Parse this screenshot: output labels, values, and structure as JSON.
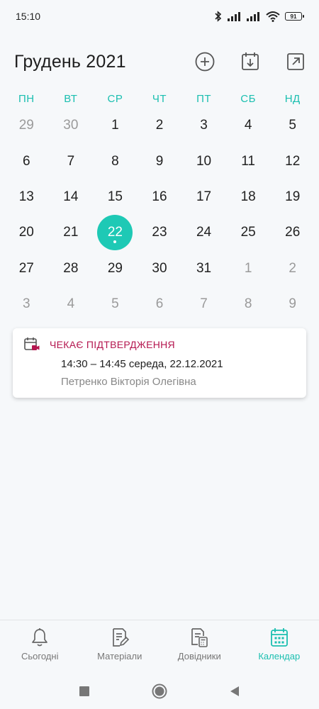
{
  "status_bar": {
    "time": "15:10",
    "battery": "91",
    "icons": [
      "bluetooth-icon",
      "signal-icon",
      "signal-icon",
      "wifi-icon",
      "battery-icon"
    ]
  },
  "header": {
    "title": "Грудень 2021",
    "actions": [
      "add-circle-icon",
      "calendar-download-icon",
      "open-external-icon"
    ]
  },
  "weekdays": [
    "ПН",
    "ВТ",
    "СР",
    "ЧТ",
    "ПТ",
    "СБ",
    "НД"
  ],
  "days": [
    {
      "label": "29",
      "muted": true
    },
    {
      "label": "30",
      "muted": true
    },
    {
      "label": "1"
    },
    {
      "label": "2"
    },
    {
      "label": "3"
    },
    {
      "label": "4"
    },
    {
      "label": "5"
    },
    {
      "label": "6"
    },
    {
      "label": "7"
    },
    {
      "label": "8"
    },
    {
      "label": "9"
    },
    {
      "label": "10"
    },
    {
      "label": "11"
    },
    {
      "label": "12"
    },
    {
      "label": "13"
    },
    {
      "label": "14"
    },
    {
      "label": "15"
    },
    {
      "label": "16"
    },
    {
      "label": "17"
    },
    {
      "label": "18"
    },
    {
      "label": "19"
    },
    {
      "label": "20"
    },
    {
      "label": "21"
    },
    {
      "label": "22",
      "selected": true,
      "has_event": true
    },
    {
      "label": "23"
    },
    {
      "label": "24"
    },
    {
      "label": "25"
    },
    {
      "label": "26"
    },
    {
      "label": "27"
    },
    {
      "label": "28"
    },
    {
      "label": "29"
    },
    {
      "label": "30"
    },
    {
      "label": "31"
    },
    {
      "label": "1",
      "muted": true
    },
    {
      "label": "2",
      "muted": true
    },
    {
      "label": "3",
      "muted": true
    },
    {
      "label": "4",
      "muted": true
    },
    {
      "label": "5",
      "muted": true
    },
    {
      "label": "6",
      "muted": true
    },
    {
      "label": "7",
      "muted": true
    },
    {
      "label": "8",
      "muted": true
    },
    {
      "label": "9",
      "muted": true
    }
  ],
  "event": {
    "icon": "calendar-video-icon",
    "status": "ЧЕКАЄ ПІДТВЕРДЖЕННЯ",
    "time": "14:30 – 14:45 середа, 22.12.2021",
    "person": "Петренко Вікторія Олегівна"
  },
  "bottom_nav": {
    "items": [
      {
        "label": "Сьогодні",
        "icon": "bell-icon"
      },
      {
        "label": "Матеріали",
        "icon": "document-edit-icon"
      },
      {
        "label": "Довідники",
        "icon": "document-calculator-icon"
      },
      {
        "label": "Календар",
        "icon": "calendar-grid-icon",
        "active": true
      }
    ]
  },
  "colors": {
    "accent": "#1ec9b5",
    "status_pending": "#b4164f",
    "background": "#f6f8fa"
  }
}
